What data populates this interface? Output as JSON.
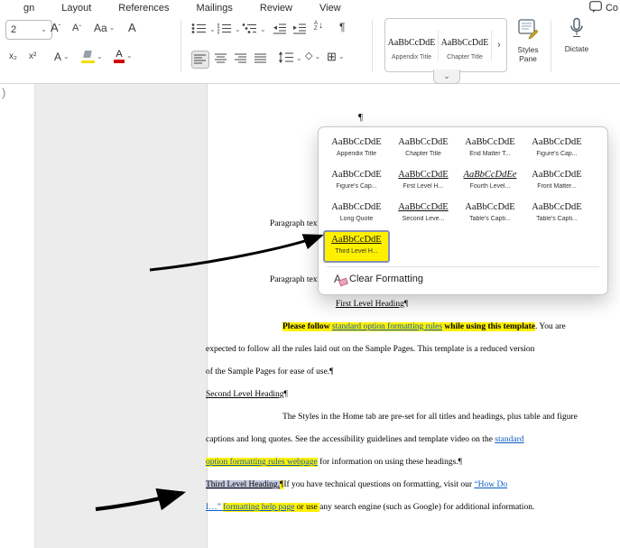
{
  "ribbon": {
    "tabs": [
      "gn",
      "Layout",
      "References",
      "Mailings",
      "Review",
      "View"
    ],
    "comments_label": "Co",
    "chevron": "⌄",
    "font_group": {
      "size_value": "2",
      "grow_font": "A",
      "shrink_font": "A",
      "change_case": "Aa",
      "clear_formatting": "A",
      "subscript": "x₂",
      "superscript": "x²",
      "text_effects": "A",
      "font_color": "A"
    },
    "paragraph_group": {
      "sort_a": "A",
      "sort_z": "Z",
      "sort_arrow": "↓",
      "pilcrow": "¶",
      "shading": "◇",
      "borders": "⊞"
    },
    "styles_gallery": {
      "items": [
        {
          "preview": "AaBbCcDdE",
          "label": "Appendix Title"
        },
        {
          "preview": "AaBbCcDdE",
          "label": "Chapter Title"
        }
      ],
      "more": "›",
      "expand": "⌄"
    },
    "styles_pane_label": "Styles Pane",
    "dictate_label": "Dictate"
  },
  "styles_panel": {
    "items": [
      {
        "preview": "AaBbCcDdE",
        "label": "Appendix Title"
      },
      {
        "preview": "AaBbCcDdE",
        "label": "Chapter Title"
      },
      {
        "preview": "AaBbCcDdE",
        "label": "End Matter T..."
      },
      {
        "preview": "AaBbCcDdE",
        "label": "Figure's Cap..."
      },
      {
        "preview": "AaBbCcDdE",
        "label": "Figure's Cap..."
      },
      {
        "preview": "AaBbCcDdE",
        "label": "First Level H..."
      },
      {
        "preview": "AaBbCcDdEe",
        "label": "Fourth Level..."
      },
      {
        "preview": "AaBbCcDdE",
        "label": "Front Matter..."
      },
      {
        "preview": "AaBbCcDdE",
        "label": "Long Quote"
      },
      {
        "preview": "AaBbCcDdE",
        "label": "Second Leve..."
      },
      {
        "preview": "AaBbCcDdE",
        "label": "Table's Capti..."
      },
      {
        "preview": "AaBbCcDdE",
        "label": "Table's Capti..."
      },
      {
        "preview": "AaBbCcDdE",
        "label": "Third Level H..."
      }
    ],
    "clear_formatting_icon": "A",
    "clear_formatting_label": "Clear Formatting"
  },
  "document": {
    "gutter_mark": ")",
    "pilcrow": "¶",
    "paragraph_text_1": "Paragraph text.¶",
    "paragraph_text_2": "Paragraph text.¶",
    "first_level_heading": "First Level Heading",
    "first_level_heading_mark": "¶",
    "p1_r1": "Please follow ",
    "p1_r2": "standard option formatting rules",
    "p1_r3": " while using this template",
    "p1_r4": ". You are",
    "p1_l2": "expected to follow all the rules laid out on the Sample Pages. This template is a reduced version",
    "p1_l3": "of the Sample Pages for ease of use.¶",
    "second_level_heading": "Second Level Heading",
    "second_level_heading_mark": "¶",
    "p2_l1": "The Styles in the Home tab are pre-set for all titles and headings, plus table and figure",
    "p2_l2a": "captions and long quotes. See the accessibility guidelines and template video on the ",
    "p2_l2b": "standard",
    "p2_l3a": "option formatting rules webpage",
    "p2_l3b": " for information on using these headings.¶",
    "p3_r1": "Third Level Heading.",
    "p3_r1_mark": "¶",
    "p3_r2": "If you have technical questions on formatting, visit our ",
    "p3_r3": "“How Do",
    "p3_l2a": "I…” ",
    "p3_l2b": "formatting help page",
    "p3_l2c": " or use ",
    "p3_l2d": "any search engine (such as Google) for additional information."
  },
  "colors": {
    "highlight_yellow": "#fff100",
    "link_blue": "#0b5bc4",
    "selection_gray": "#c3c8de",
    "style_selected_border": "#8691b3"
  }
}
